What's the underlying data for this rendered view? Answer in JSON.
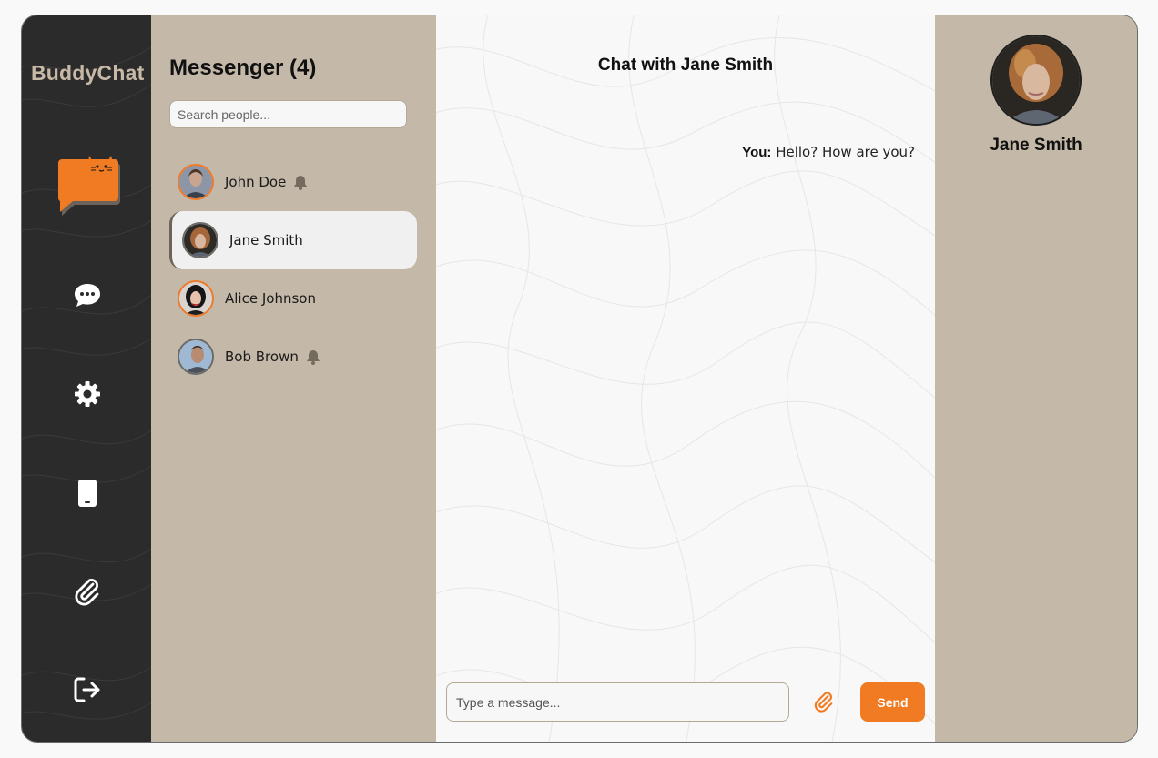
{
  "app": {
    "name": "BuddyChat"
  },
  "nav": {
    "items": [
      {
        "icon": "chat-bubble-icon"
      },
      {
        "icon": "gear-icon"
      },
      {
        "icon": "mobile-phone-icon"
      },
      {
        "icon": "paperclip-icon"
      },
      {
        "icon": "logout-icon"
      }
    ]
  },
  "people": {
    "title": "Messenger (4)",
    "search_placeholder": "Search people...",
    "contacts": [
      {
        "name": "John Doe",
        "notification": true,
        "active": false
      },
      {
        "name": "Jane Smith",
        "notification": false,
        "active": true
      },
      {
        "name": "Alice Johnson",
        "notification": false,
        "active": false
      },
      {
        "name": "Bob Brown",
        "notification": true,
        "active": false
      }
    ]
  },
  "chat": {
    "title": "Chat with Jane Smith",
    "messages": [
      {
        "sender": "You:",
        "text": "Hello? How are you?"
      }
    ],
    "input_placeholder": "Type a message...",
    "send_label": "Send"
  },
  "profile": {
    "name": "Jane Smith"
  },
  "colors": {
    "accent": "#f07b23",
    "rail": "#2b2b2b",
    "panel": "#c4b8a8",
    "chat_bg": "#f8f8f8"
  }
}
